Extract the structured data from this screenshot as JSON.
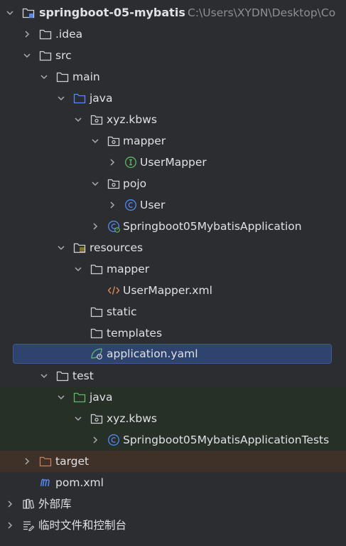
{
  "tree": {
    "root": {
      "label": "springboot-05-mybatis",
      "path": "C:\\Users\\XYDN\\Desktop\\Co"
    },
    "idea": {
      "label": ".idea"
    },
    "src": {
      "label": "src"
    },
    "main": {
      "label": "main"
    },
    "main_java": {
      "label": "java"
    },
    "main_pkg": {
      "label": "xyz.kbws"
    },
    "mapper_pkg": {
      "label": "mapper"
    },
    "user_mapper": {
      "label": "UserMapper"
    },
    "pojo_pkg": {
      "label": "pojo"
    },
    "user_class": {
      "label": "User"
    },
    "app_class": {
      "label": "Springboot05MybatisApplication"
    },
    "resources": {
      "label": "resources"
    },
    "res_mapper": {
      "label": "mapper"
    },
    "user_mapper_xml": {
      "label": "UserMapper.xml"
    },
    "static_dir": {
      "label": "static"
    },
    "templates_dir": {
      "label": "templates"
    },
    "app_yaml": {
      "label": "application.yaml"
    },
    "test": {
      "label": "test"
    },
    "test_java": {
      "label": "java"
    },
    "test_pkg": {
      "label": "xyz.kbws"
    },
    "app_tests": {
      "label": "Springboot05MybatisApplicationTests"
    },
    "target": {
      "label": "target"
    },
    "pom": {
      "label": "pom.xml"
    },
    "ext_libs": {
      "label": "外部库"
    },
    "scratches": {
      "label": "临时文件和控制台"
    }
  },
  "colors": {
    "background": "#2b2d30",
    "selection": "#2e436e",
    "test_row": "#263026",
    "excluded_row": "#3f3127",
    "source_folder": "#548af7",
    "test_folder": "#5fb865",
    "excluded_folder": "#c77d55",
    "interface_icon": "#5fb865",
    "class_icon": "#548af7",
    "xml_icon": "#e2875a",
    "spring_icon": "#5fb865",
    "maven_icon": "#548af7"
  },
  "icons": {
    "folder": "folder-icon",
    "package": "package-icon",
    "interface": "interface-icon",
    "class": "class-icon",
    "xml": "xml-file-icon",
    "yaml": "spring-yaml-icon",
    "maven": "maven-icon",
    "library": "library-icon",
    "scratches": "scratches-icon"
  }
}
